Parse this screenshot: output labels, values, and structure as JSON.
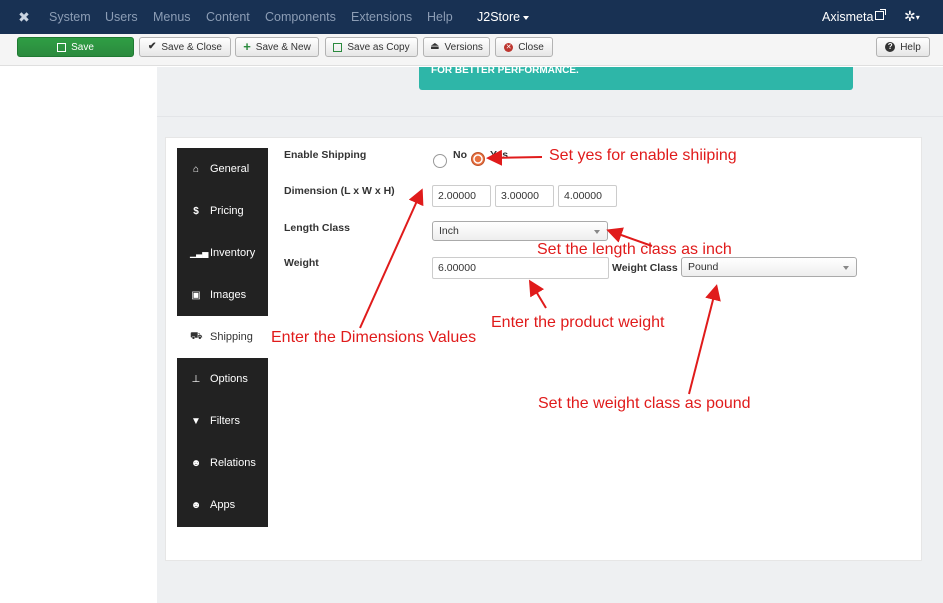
{
  "menubar": {
    "logo_icon": "joomla-icon",
    "items": [
      "System",
      "Users",
      "Menus",
      "Content",
      "Components",
      "Extensions",
      "Help"
    ],
    "active_item": "J2Store",
    "user": "Axismeta"
  },
  "toolbar": {
    "save": "Save",
    "save_close": "Save & Close",
    "save_new": "Save & New",
    "save_copy": "Save as Copy",
    "versions": "Versions",
    "close": "Close",
    "help": "Help"
  },
  "notice": {
    "text": "FOR BETTER PERFORMANCE.",
    "color": "#2eb6a8"
  },
  "tabs": [
    {
      "label": "General",
      "icon": "home-icon"
    },
    {
      "label": "Pricing",
      "icon": "dollar-icon"
    },
    {
      "label": "Inventory",
      "icon": "signal-icon"
    },
    {
      "label": "Images",
      "icon": "image-icon"
    },
    {
      "label": "Shipping",
      "icon": "truck-icon"
    },
    {
      "label": "Options",
      "icon": "sitemap-icon"
    },
    {
      "label": "Filters",
      "icon": "filter-icon"
    },
    {
      "label": "Relations",
      "icon": "users-icon"
    },
    {
      "label": "Apps",
      "icon": "users-icon"
    }
  ],
  "form": {
    "enable_shipping_label": "Enable Shipping",
    "no_label": "No",
    "yes_label": "Yes",
    "dimension_label": "Dimension (L x W x H)",
    "length_value": "2.00000",
    "width_value": "3.00000",
    "height_value": "4.00000",
    "length_class_label": "Length Class",
    "length_class_value": "Inch",
    "weight_label": "Weight",
    "weight_value": "6.00000",
    "weight_class_label": "Weight Class",
    "weight_class_value": "Pound"
  },
  "annotations": {
    "enable": "Set yes for enable shiiping",
    "length_class": "Set the length class as inch",
    "weight": "Enter the product weight",
    "dimensions": "Enter the Dimensions Values",
    "weight_class": "Set the weight class as pound",
    "color": "#e01b1b"
  }
}
